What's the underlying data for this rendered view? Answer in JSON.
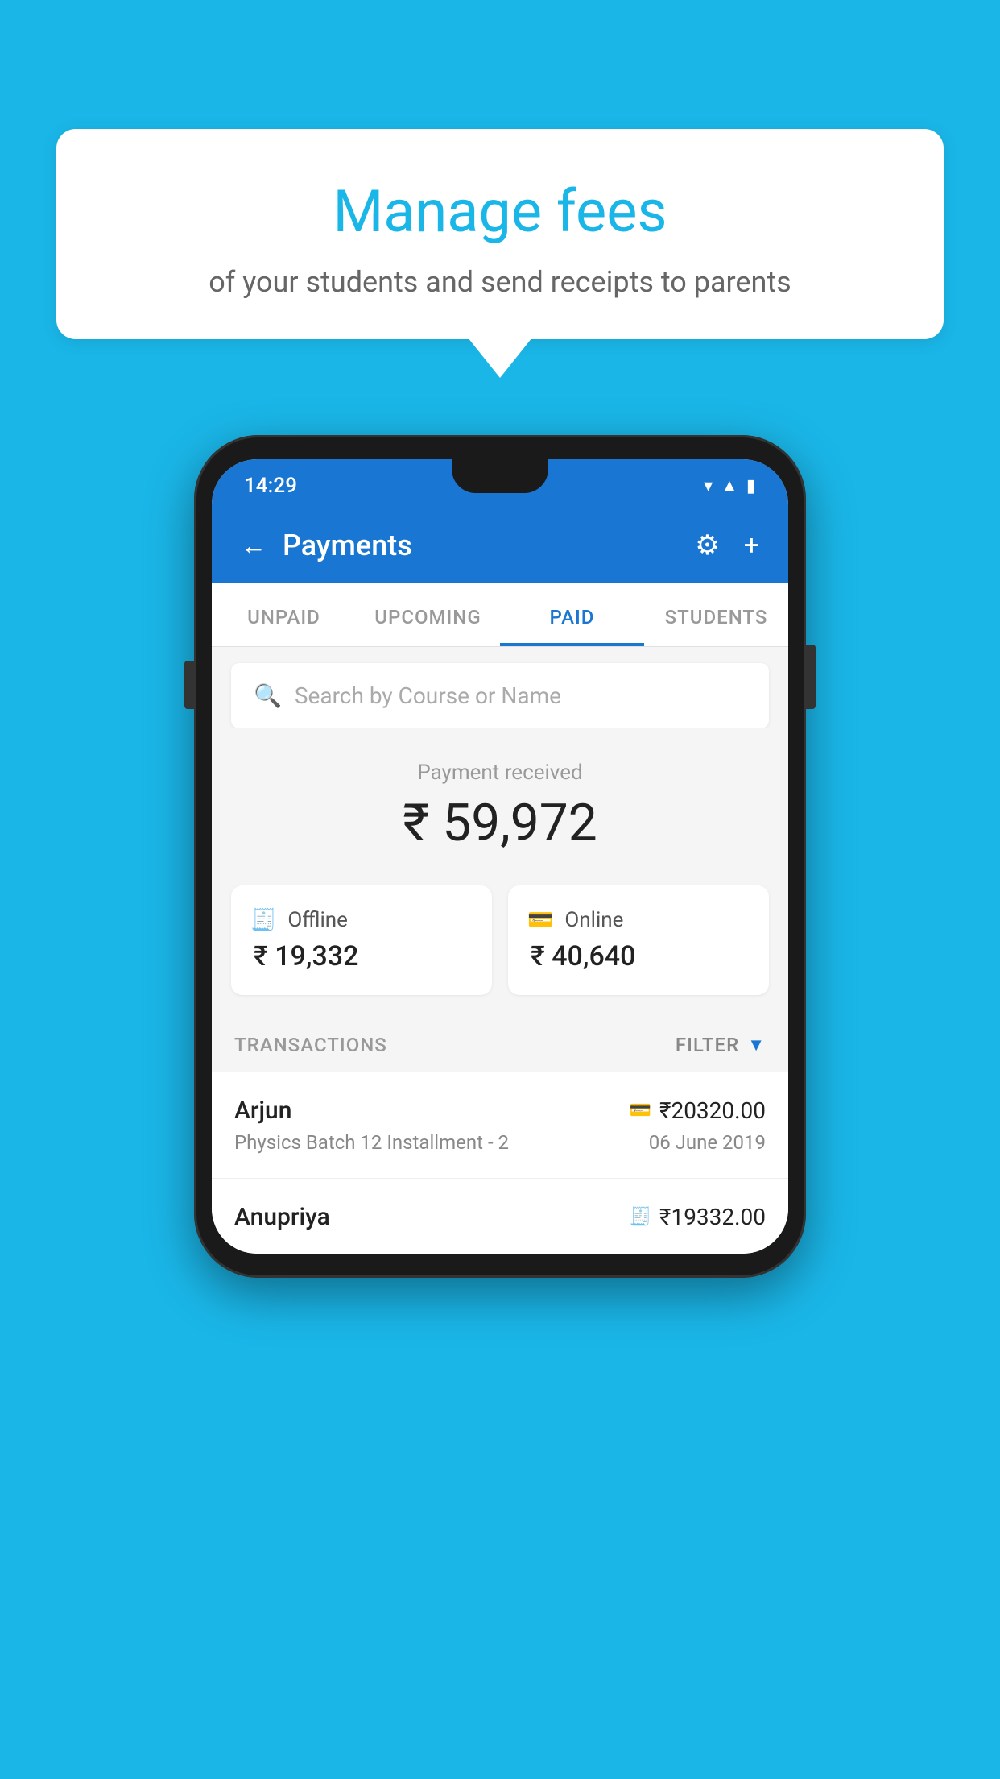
{
  "background_color": "#1ab6e8",
  "bubble": {
    "title": "Manage fees",
    "subtitle": "of your students and send receipts to parents"
  },
  "status_bar": {
    "time": "14:29",
    "icons": [
      "wifi",
      "signal",
      "battery"
    ]
  },
  "header": {
    "title": "Payments",
    "back_label": "←",
    "gear_icon": "⚙",
    "plus_icon": "+"
  },
  "tabs": [
    {
      "label": "UNPAID",
      "active": false
    },
    {
      "label": "UPCOMING",
      "active": false
    },
    {
      "label": "PAID",
      "active": true
    },
    {
      "label": "STUDENTS",
      "active": false
    }
  ],
  "search": {
    "placeholder": "Search by Course or Name"
  },
  "payment_summary": {
    "label": "Payment received",
    "amount": "₹ 59,972",
    "offline_label": "Offline",
    "offline_amount": "₹ 19,332",
    "online_label": "Online",
    "online_amount": "₹ 40,640"
  },
  "transactions": {
    "section_label": "TRANSACTIONS",
    "filter_label": "FILTER",
    "rows": [
      {
        "name": "Arjun",
        "course": "Physics Batch 12 Installment - 2",
        "amount": "₹20320.00",
        "date": "06 June 2019",
        "icon_type": "card"
      },
      {
        "name": "Anupriya",
        "course": "",
        "amount": "₹19332.00",
        "date": "",
        "icon_type": "cash"
      }
    ]
  }
}
